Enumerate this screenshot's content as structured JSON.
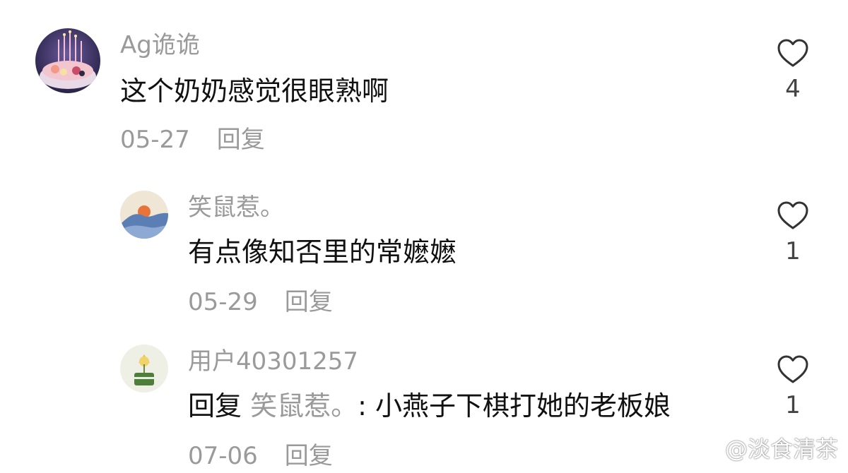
{
  "comments": [
    {
      "username": "Ag诡诡",
      "text": "这个奶奶感觉很眼熟啊",
      "date": "05-27",
      "reply_label": "回复",
      "likes": "4"
    },
    {
      "username": "笑鼠惹。",
      "text": "有点像知否里的常嬷嬷",
      "date": "05-29",
      "reply_label": "回复",
      "likes": "1"
    },
    {
      "username": "用户40301257",
      "reply_prefix": "回复",
      "reply_target": "笑鼠惹。",
      "text": ": 小燕子下棋打她的老板娘",
      "date": "07-06",
      "reply_label": "回复",
      "likes": "1"
    }
  ],
  "icons": {
    "like": "heart-outline-icon",
    "watermark": "weibo-logo-icon"
  },
  "watermark": {
    "text": "@淡食清茶"
  },
  "colors": {
    "text_primary": "#111111",
    "text_secondary": "#9a9a9a",
    "background": "#ffffff"
  }
}
